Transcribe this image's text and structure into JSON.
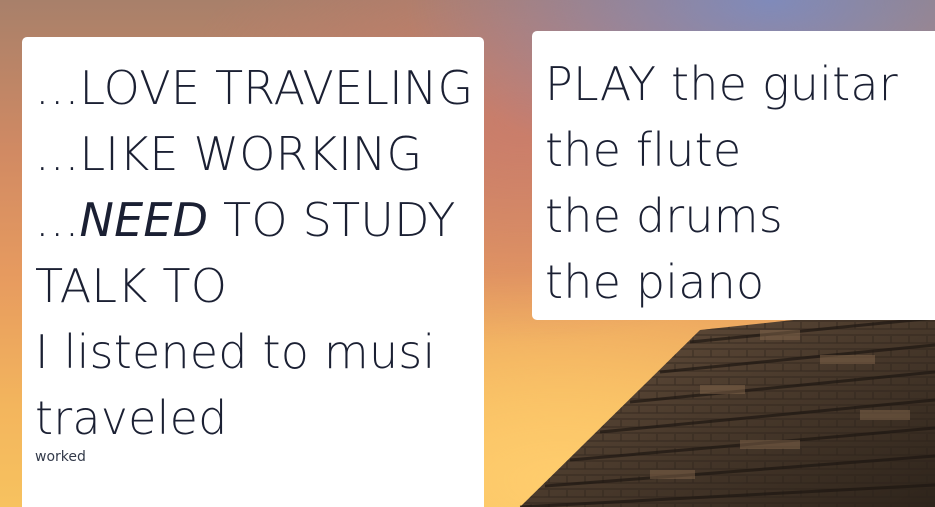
{
  "background": {
    "scene": "pyramid-at-sunset",
    "sky_colors": [
      "#7f8fc6",
      "#d18a63",
      "#f3b55d"
    ]
  },
  "left_card": {
    "lines": [
      {
        "prefix": "...",
        "emphasis": "",
        "text": "LOVE TRAVELING"
      },
      {
        "prefix": "...",
        "emphasis": "",
        "text": "LIKE WORKING"
      },
      {
        "prefix": "...",
        "emphasis": "NEED",
        "text": " TO STUDY"
      },
      {
        "prefix": "",
        "emphasis": "",
        "text": "TALK TO"
      },
      {
        "prefix": "",
        "emphasis": "",
        "text": "I listened to musi"
      },
      {
        "prefix": "",
        "emphasis": "",
        "text": "traveled"
      }
    ],
    "small_text": "worked"
  },
  "right_card": {
    "lines": [
      "PLAY the guitar",
      "the flute",
      "the drums",
      "the piano"
    ]
  }
}
